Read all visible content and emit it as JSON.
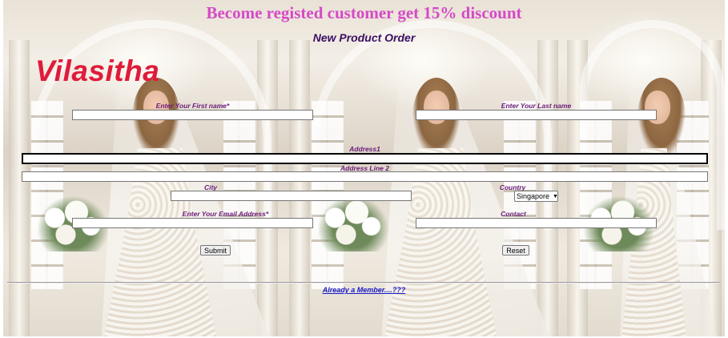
{
  "promo_banner": "Become registed customer get 15% discount",
  "order_title": "New Product Order",
  "brand_name": "Vilasitha",
  "form": {
    "first_name": {
      "label": "Enter Your First name*",
      "value": ""
    },
    "last_name": {
      "label": "Enter Your Last name",
      "value": ""
    },
    "address1": {
      "label": "Address1",
      "value": ""
    },
    "address2": {
      "label": "Address Line 2",
      "value": ""
    },
    "city": {
      "label": "City",
      "value": ""
    },
    "country": {
      "label": "Country",
      "selected": "Singapore"
    },
    "email": {
      "label": "Enter Your Email Address*",
      "value": ""
    },
    "contact": {
      "label": "Contact",
      "value": ""
    },
    "submit_label": "Submit",
    "reset_label": "Reset"
  },
  "member_link": "Already a Member....???",
  "colors": {
    "promo": "#d54ac6",
    "order_title": "#3b0f63",
    "brand": "#e01b3a",
    "labels": "#6a1a78",
    "link": "#1a1ac7"
  }
}
